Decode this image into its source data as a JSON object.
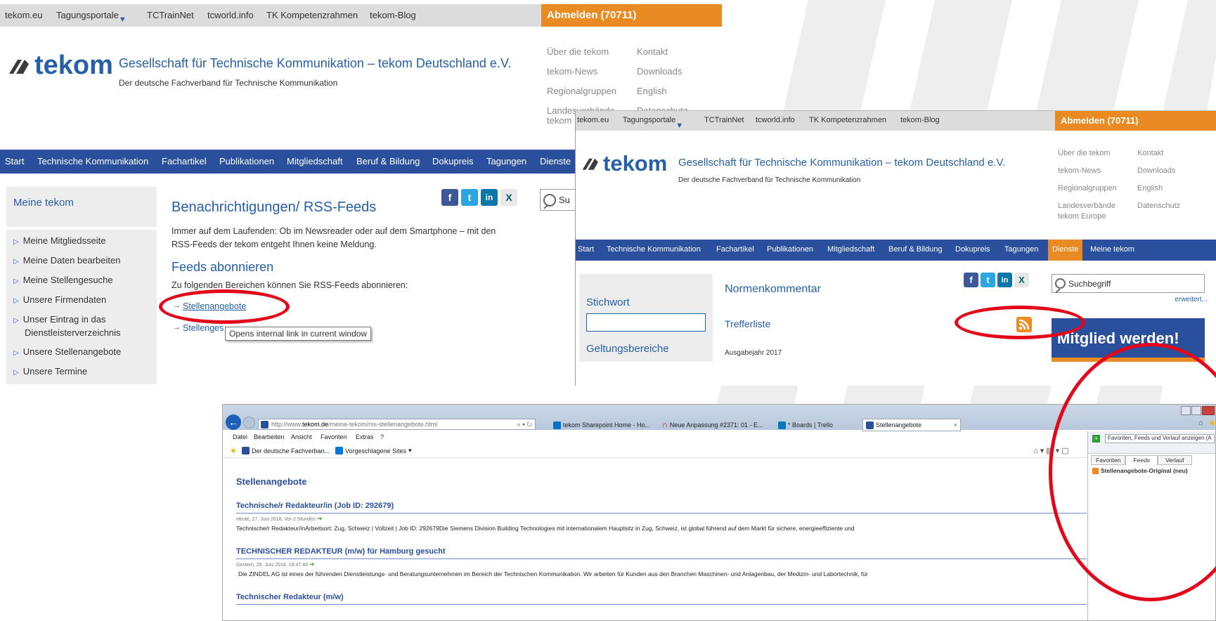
{
  "panel1": {
    "topnav": [
      "tekom.eu",
      "Tagungsportale",
      "TCTrainNet",
      "tcworld.info",
      "TK Kompetenzrahmen",
      "tekom-Blog"
    ],
    "abmelden": "Abmelden (70711)",
    "logo_text": "tekom",
    "org_title": "Gesellschaft für Technische Kommunikation – tekom Deutschland e.V.",
    "org_subtitle": "Der deutsche Fachverband für Technische Kommunikation",
    "quicklinks": {
      "col1": [
        "Über die tekom",
        "tekom-News",
        "Regionalgruppen",
        "Landesverbände",
        "tekom"
      ],
      "col2": [
        "Kontakt",
        "Downloads",
        "English",
        "Datenschutz"
      ]
    },
    "mainnav": [
      "Start",
      "Technische Kommunikation",
      "Fachartikel",
      "Publikationen",
      "Mitgliedschaft",
      "Beruf & Bildung",
      "Dokupreis",
      "Tagungen",
      "Dienste"
    ],
    "sidebar_title": "Meine tekom",
    "sidebar_items": [
      "Meine Mitgliedsseite",
      "Meine Daten bearbeiten",
      "Meine Stellengesuche",
      "Unsere Firmendaten",
      "Unser Eintrag in das",
      "Dienstleisterverzeichnis",
      "Unsere Stellenangebote",
      "Unsere Termine"
    ],
    "page_heading": "Benachrichtigungen/ RSS-Feeds",
    "intro_line1": "Immer auf dem Laufenden: Ob im Newsreader oder auf dem Smartphone – mit den",
    "intro_line2": "RSS-Feeds der tekom entgeht Ihnen keine Meldung.",
    "feeds_heading": "Feeds abonnieren",
    "feeds_intro": "Zu folgenden Bereichen können Sie RSS-Feeds abonnieren:",
    "feed_link1": "Stellenangebote",
    "feed_link2": "Stellenges",
    "tooltip": "Opens internal link in current window",
    "search_partial": "Su"
  },
  "panel2": {
    "topnav": [
      "tekom.eu",
      "Tagungsportale",
      "TCTrainNet",
      "tcworld.info",
      "TK Kompetenzrahmen",
      "tekom-Blog"
    ],
    "abmelden": "Abmelden (70711)",
    "logo_text": "tekom",
    "org_title": "Gesellschaft für Technische Kommunikation – tekom Deutschland e.V.",
    "org_subtitle": "Der deutsche Fachverband für Technische Kommunikation",
    "quicklinks": {
      "col1": [
        "Über die tekom",
        "tekom-News",
        "Regionalgruppen",
        "Landesverbände",
        "tekom Europe"
      ],
      "col2": [
        "Kontakt",
        "Downloads",
        "English",
        "Datenschutz"
      ]
    },
    "mainnav": [
      "Start",
      "Technische Kommunikation",
      "Fachartikel",
      "Publikationen",
      "Mitgliedschaft",
      "Beruf & Bildung",
      "Dokupreis",
      "Tagungen",
      "Dienste",
      "Meine tekom"
    ],
    "stichwort": "Stichwort",
    "geltungsbereiche": "Geltungsbereiche",
    "heading": "Normenkommentar",
    "trefferliste": "Trefferliste",
    "ausgabejahr": "Ausgabejahr 2017",
    "search_placeholder": "Suchbegriff",
    "erweitert": "erweitert...",
    "banner": "Mitglied werden!"
  },
  "panel3": {
    "url_prefix": "http://www.",
    "url_domain": "tekom.de",
    "url_path": "/meine-tekom/rss-stellenangebote.html",
    "tabs": [
      "tekom Sharepoint Home - Ho...",
      "Neue Anpassung #2371: 01 - E...",
      "* Boards | Trello",
      "Stellenangebote"
    ],
    "menu": [
      "Datei",
      "Bearbeiten",
      "Ansicht",
      "Favoriten",
      "Extras",
      "?"
    ],
    "favbar": [
      "Der deutsche Fachverban...",
      "Vorgeschlagene Sites"
    ],
    "page_title": "Stellenangebote",
    "items": [
      {
        "title": "Technische/r Redakteur/in (Job ID: 292679)",
        "meta": "Heute, 27. Juni 2018, Vor 2 Stunden",
        "desc": "Technische/r Redakteur/inArbeitsort: Zug, Schweiz | Vollzeit | Job ID: 292679Die Siemens Division Building Technologies mit internationalem Hauptsitz in Zug, Schweiz, ist global führend auf dem Markt für sichere, energieeffiziente und"
      },
      {
        "title": "TECHNISCHER REDAKTEUR (m/w) für Hamburg gesucht",
        "meta": "Gestern, 26. Juni 2018, 18:47:48",
        "desc": "Die ZINDEL AG ist eines der führenden Dienstleistungs- und Beratungsunternehmen im Bereich der Technischen Kommunikation. Wir arbeiten für Kunden aus den Branchen Maschinen- und Anlagenbau, der Medizin- und Labortechnik, für"
      },
      {
        "title": "Technischer Redakteur (m/w)",
        "meta": "",
        "desc": ""
      }
    ],
    "favpane_hint": "Favoriten, Feeds und Verlauf anzeigen (A",
    "favpane_tabs": [
      "Favoriten",
      "Feeds",
      "Verlauf"
    ],
    "favpane_feed": "Stellenangebote-Original (neu)"
  },
  "colors": {
    "brand_blue": "#2560a8",
    "nav_blue": "#2a4f9c",
    "orange": "#e98b22",
    "highlight_red": "#e3071a"
  }
}
